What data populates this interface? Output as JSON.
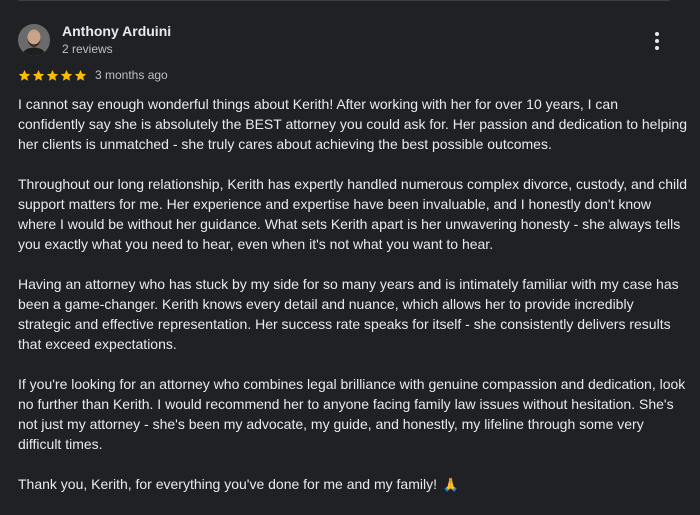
{
  "reviewer": {
    "name": "Anthony Arduini",
    "meta": "2 reviews",
    "avatar_icon": "person-avatar"
  },
  "menu": {
    "icon": "more-vertical-icon"
  },
  "rating": {
    "stars": 5,
    "max_stars": 5,
    "star_color": "#fbbc04",
    "date": "3 months ago"
  },
  "review": {
    "paragraphs": [
      "I cannot say enough wonderful things about Kerith! After working with her for over 10 years, I can confidently say she is absolutely the BEST attorney you could ask for. Her passion and dedication to helping her clients is unmatched - she truly cares about achieving the best possible outcomes.",
      "Throughout our long relationship, Kerith has expertly handled numerous complex divorce, custody, and child support matters for me. Her experience and expertise have been invaluable, and I honestly don't know where I would be without her guidance. What sets Kerith apart is her unwavering honesty - she always tells you exactly what you need to hear, even when it's not what you want to hear.",
      "Having an attorney who has stuck by my side for so many years and is intimately familiar with my case has been a game-changer. Kerith knows every detail and nuance, which allows her to provide incredibly strategic and effective representation. Her success rate speaks for itself - she consistently delivers results that exceed expectations.",
      "If you're looking for an attorney who combines legal brilliance with genuine compassion and dedication, look no further than Kerith. I would recommend her to anyone facing family law issues without hesitation. She's not just my attorney - she's been my advocate, my guide, and honestly, my lifeline through some very difficult times.",
      "Thank you, Kerith, for everything you've done for me and my family!"
    ],
    "closing_emoji": "🙏",
    "closing_emoji_name": "folded-hands-icon"
  },
  "colors": {
    "background": "#202124",
    "text": "#e8eaed",
    "secondary_text": "#bdc1c6",
    "star": "#fbbc04"
  }
}
